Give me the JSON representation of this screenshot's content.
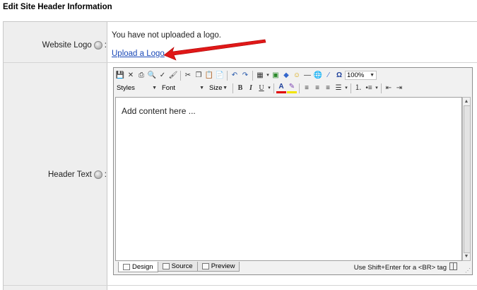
{
  "page": {
    "title": "Edit Site Header Information"
  },
  "rows": {
    "logo": {
      "label": "Website Logo",
      "label_suffix": ":",
      "status_text": "You have not uploaded a logo.",
      "upload_link": "Upload a Logo"
    },
    "header_text": {
      "label": "Header Text",
      "label_suffix": ":"
    }
  },
  "editor": {
    "styles_label": "Styles",
    "font_label": "Font",
    "size_label": "Size",
    "zoom_value": "100%",
    "content_placeholder": "Add content here ...",
    "tabs": [
      "Design",
      "Source",
      "Preview"
    ],
    "active_tab": "Design",
    "hint": "Use Shift+Enter for a <BR> tag",
    "toolbar1_icons": [
      "save-icon",
      "cancel-icon",
      "print-icon",
      "find-icon",
      "spellcheck-icon",
      "format-painter-icon",
      "cut-icon",
      "copy-icon",
      "paste-icon",
      "paste-text-icon",
      "undo-icon",
      "redo-icon",
      "table-icon",
      "image-icon",
      "special-object-icon",
      "emoticon-icon",
      "horizontal-rule-icon",
      "hyperlink-icon",
      "remove-format-icon",
      "omega-icon"
    ],
    "toolbar2_icons": [
      "bold-icon",
      "italic-icon",
      "underline-icon",
      "font-color-icon",
      "highlight-icon",
      "align-left-icon",
      "align-center-icon",
      "align-right-icon",
      "justify-icon",
      "ordered-list-icon",
      "unordered-list-icon",
      "outdent-icon",
      "indent-icon"
    ]
  },
  "colors": {
    "link": "#1a49b8",
    "arrow": "#e01818",
    "label_bg": "#eeeeee"
  }
}
